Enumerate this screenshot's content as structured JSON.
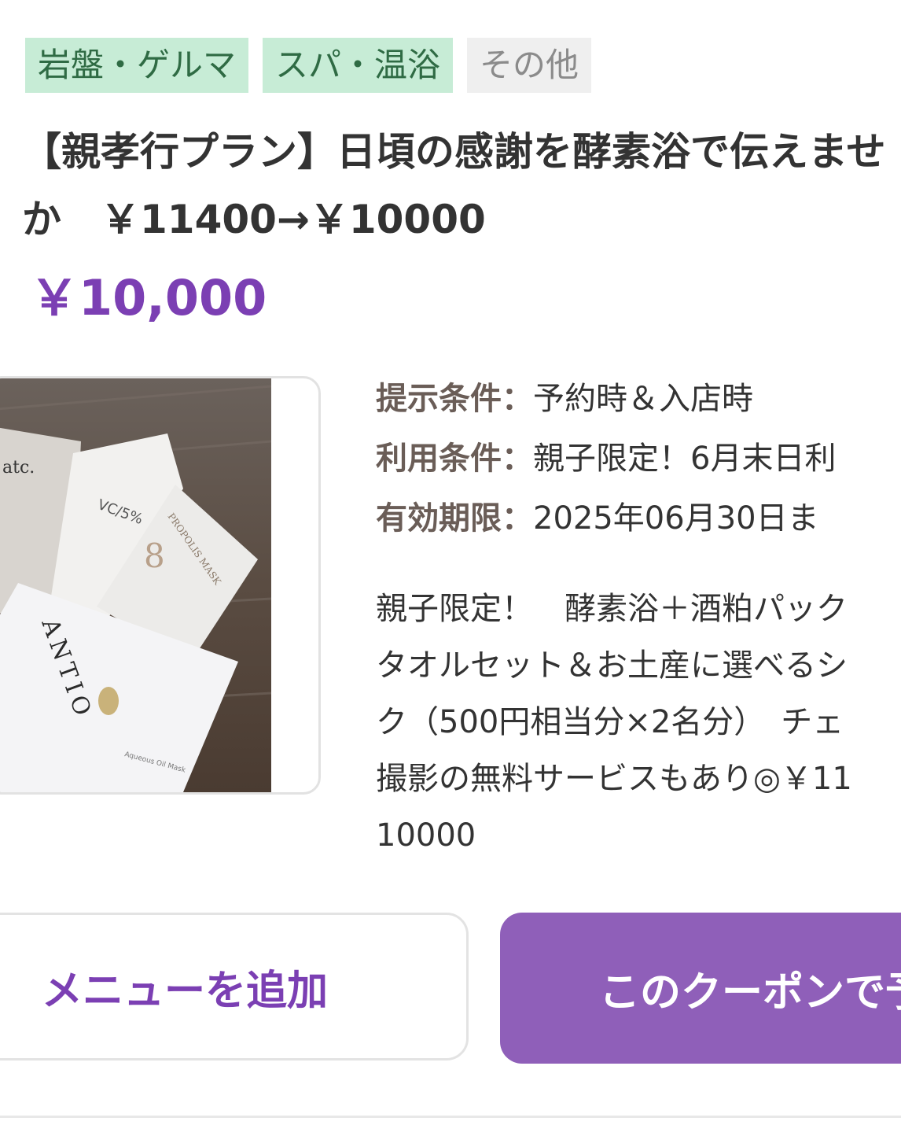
{
  "tags": [
    {
      "label": "岩盤・ゲルマ",
      "style": "green"
    },
    {
      "label": "スパ・温浴",
      "style": "green"
    },
    {
      "label": "その他",
      "style": "gray"
    }
  ],
  "coupon": {
    "title_line1": "【親孝行プラン】日頃の感謝を酵素浴で伝えませ",
    "title_line2": "か　￥11400→￥10000",
    "price": "￥10,000",
    "photo_text": {
      "brand_top": "atc.",
      "pack_vc": "VC/5%",
      "pack_propolis": "PROPOLIS MASK",
      "pack_antio": "ANTIO",
      "pack_small": "Aqueous Oil Mask"
    },
    "conditions": [
      {
        "label": "提示条件：",
        "value": "予約時＆入店時"
      },
      {
        "label": "利用条件：",
        "value": "親子限定！6月末日利"
      },
      {
        "label": "有効期限：",
        "value": "2025年06月30日ま"
      }
    ],
    "description_lines": [
      "親子限定！　酵素浴＋酒粕パック",
      "タオルセット＆お土産に選べるシ",
      "ク（500円相当分×2名分）　チェ",
      "撮影の無料サービスもあり◎￥11",
      "10000"
    ]
  },
  "buttons": {
    "add_menu": "メニューを追加",
    "book_with_coupon": "このクーポンで予"
  },
  "colors": {
    "accent": "#7b3fb3",
    "button_bg": "#8f5fb9",
    "tag_green_bg": "#c7ecd6",
    "tag_gray_bg": "#efefef"
  }
}
